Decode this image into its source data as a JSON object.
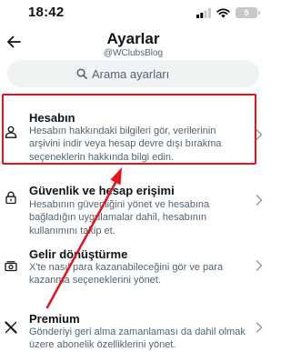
{
  "status_bar": {
    "time": "18:42",
    "battery": "5"
  },
  "header": {
    "title": "Ayarlar",
    "subtitle": "@WClubsBlog"
  },
  "search": {
    "placeholder": "Arama ayarları"
  },
  "items": [
    {
      "title": "Hesabın",
      "description": "Hesabın hakkındaki bilgileri gör, verilerinin arşivini indir veya hesap devre dışı bırakma seçeneklerin hakkında bilgi edin.",
      "icon": "person-icon"
    },
    {
      "title": "Güvenlik ve hesap erişimi",
      "description": "Hesabının güvenliğini yönet ve hesabına bağladığın uygulamalar dahil, hesabının kullanımını takip et.",
      "icon": "lock-icon"
    },
    {
      "title": "Gelir dönüştürme",
      "description": "X'te nasıl para kazanabileceğini gör ve para kazanma seçeneklerini yönet.",
      "icon": "money-icon"
    },
    {
      "title": "Premium",
      "description": "Gönderiyi geri alma zamanlaması da dahil olmak üzere abonelik özelliklerini yönet.",
      "icon": "x-logo-icon"
    }
  ],
  "colors": {
    "highlight": "#e4141b",
    "secondary_text": "#536471",
    "search_bg": "#eff3f4"
  }
}
